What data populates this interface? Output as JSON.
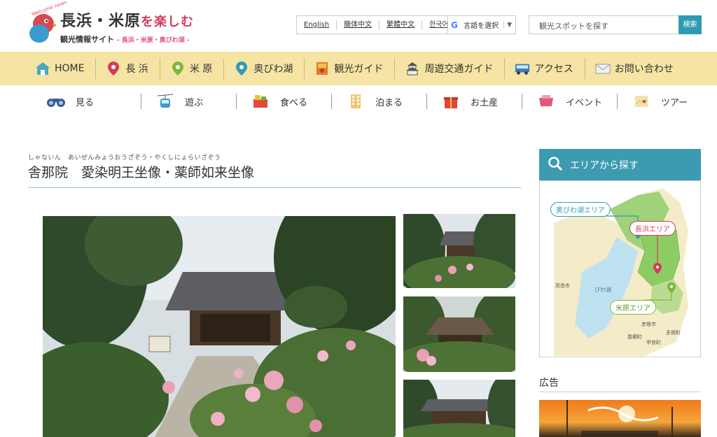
{
  "header": {
    "welcome": "Welcome news",
    "logo_title_1": "長浜・米原",
    "logo_title_2": "を楽しむ",
    "logo_sub": "観光情報サイト",
    "logo_sub_areas": "- 長浜・米原・奥びわ湖 -",
    "languages": [
      "English",
      "簡体中文",
      "繁體中文",
      "한국어"
    ],
    "translate_label": "言語を選択",
    "search_placeholder": "観光スポットを探す",
    "search_button": "検索"
  },
  "mainnav": [
    {
      "label": "HOME",
      "icon": "house-icon"
    },
    {
      "label": "長 浜",
      "icon": "pin-red-icon"
    },
    {
      "label": "米 原",
      "icon": "pin-green-icon"
    },
    {
      "label": "奥びわ湖",
      "icon": "pin-blue-icon"
    },
    {
      "label": "観光ガイド",
      "icon": "guidebook-icon"
    },
    {
      "label": "周遊交通ガイド",
      "icon": "castle-icon"
    },
    {
      "label": "アクセス",
      "icon": "bus-icon"
    },
    {
      "label": "お問い合わせ",
      "icon": "envelope-icon"
    }
  ],
  "subnav": [
    {
      "label": "見る",
      "icon": "binoculars-icon"
    },
    {
      "label": "遊ぶ",
      "icon": "ropeway-icon"
    },
    {
      "label": "食べる",
      "icon": "food-icon"
    },
    {
      "label": "泊まる",
      "icon": "hotel-icon"
    },
    {
      "label": "お土産",
      "icon": "gift-icon"
    },
    {
      "label": "イベント",
      "icon": "event-icon"
    },
    {
      "label": "ツアー",
      "icon": "map-icon"
    }
  ],
  "page": {
    "ruby": "しゃないん　あいぜんみょうおうざぞう・やくしにょらいざぞう",
    "title": "舎那院　愛染明王坐像・薬師如来坐像"
  },
  "sidebar": {
    "area_heading": "エリアから探す",
    "map_labels": {
      "okubiwako": "奥びわ湖エリア",
      "nagahama": "長浜エリア",
      "maibara": "米原エリア",
      "takashima": "高島市",
      "biwako": "びわ湖",
      "hikone": "彦根市",
      "toyosato": "豊郷町",
      "koura": "甲良町",
      "taga": "多賀町"
    },
    "ad_label": "広告"
  },
  "colors": {
    "nav_bg": "#f5e4a3",
    "accent": "#3c9bb1",
    "okubiwako": "#2f9bb3",
    "nagahama": "#d23c5a",
    "maibara": "#7fb83a"
  }
}
